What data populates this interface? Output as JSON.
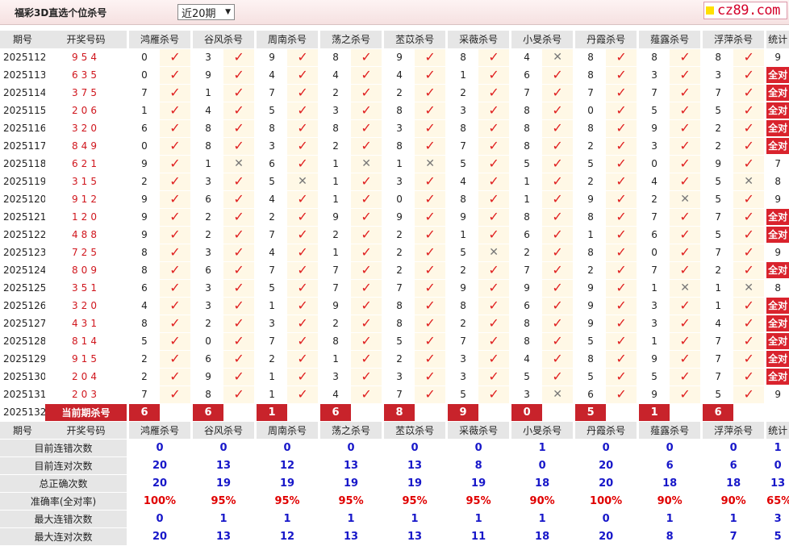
{
  "header": {
    "title": "福彩3D直选个位杀号",
    "period_select": "近20期",
    "logo_text": "cz89.com"
  },
  "columns": {
    "period": "期号",
    "draw": "开奖号码",
    "stat": "统计",
    "experts": [
      "鸿雁杀号",
      "谷风杀号",
      "周南杀号",
      "荡之杀号",
      "苤苡杀号",
      "采薇杀号",
      "小旻杀号",
      "丹霞杀号",
      "薤露杀号",
      "浮萍杀号"
    ]
  },
  "rows": [
    {
      "period": "2025112",
      "draw": "954",
      "preds": [
        [
          0,
          1
        ],
        [
          3,
          1
        ],
        [
          9,
          1
        ],
        [
          8,
          1
        ],
        [
          9,
          1
        ],
        [
          8,
          1
        ],
        [
          4,
          0
        ],
        [
          8,
          1
        ],
        [
          8,
          1
        ],
        [
          8,
          1
        ]
      ],
      "stat": "9"
    },
    {
      "period": "2025113",
      "draw": "635",
      "preds": [
        [
          0,
          1
        ],
        [
          9,
          1
        ],
        [
          4,
          1
        ],
        [
          4,
          1
        ],
        [
          4,
          1
        ],
        [
          1,
          1
        ],
        [
          6,
          1
        ],
        [
          8,
          1
        ],
        [
          3,
          1
        ],
        [
          3,
          1
        ]
      ],
      "stat": "全对"
    },
    {
      "period": "2025114",
      "draw": "375",
      "preds": [
        [
          7,
          1
        ],
        [
          1,
          1
        ],
        [
          7,
          1
        ],
        [
          2,
          1
        ],
        [
          2,
          1
        ],
        [
          2,
          1
        ],
        [
          7,
          1
        ],
        [
          7,
          1
        ],
        [
          7,
          1
        ],
        [
          7,
          1
        ]
      ],
      "stat": "全对"
    },
    {
      "period": "2025115",
      "draw": "206",
      "preds": [
        [
          1,
          1
        ],
        [
          4,
          1
        ],
        [
          5,
          1
        ],
        [
          3,
          1
        ],
        [
          8,
          1
        ],
        [
          3,
          1
        ],
        [
          8,
          1
        ],
        [
          0,
          1
        ],
        [
          5,
          1
        ],
        [
          5,
          1
        ]
      ],
      "stat": "全对"
    },
    {
      "period": "2025116",
      "draw": "320",
      "preds": [
        [
          6,
          1
        ],
        [
          8,
          1
        ],
        [
          8,
          1
        ],
        [
          8,
          1
        ],
        [
          3,
          1
        ],
        [
          8,
          1
        ],
        [
          8,
          1
        ],
        [
          8,
          1
        ],
        [
          9,
          1
        ],
        [
          2,
          1
        ]
      ],
      "stat": "全对"
    },
    {
      "period": "2025117",
      "draw": "849",
      "preds": [
        [
          0,
          1
        ],
        [
          8,
          1
        ],
        [
          3,
          1
        ],
        [
          2,
          1
        ],
        [
          8,
          1
        ],
        [
          7,
          1
        ],
        [
          8,
          1
        ],
        [
          2,
          1
        ],
        [
          3,
          1
        ],
        [
          2,
          1
        ]
      ],
      "stat": "全对"
    },
    {
      "period": "2025118",
      "draw": "621",
      "preds": [
        [
          9,
          1
        ],
        [
          1,
          0
        ],
        [
          6,
          1
        ],
        [
          1,
          0
        ],
        [
          1,
          0
        ],
        [
          5,
          1
        ],
        [
          5,
          1
        ],
        [
          5,
          1
        ],
        [
          0,
          1
        ],
        [
          9,
          1
        ]
      ],
      "stat": "7"
    },
    {
      "period": "2025119",
      "draw": "315",
      "preds": [
        [
          2,
          1
        ],
        [
          3,
          1
        ],
        [
          5,
          0
        ],
        [
          1,
          1
        ],
        [
          3,
          1
        ],
        [
          4,
          1
        ],
        [
          1,
          1
        ],
        [
          2,
          1
        ],
        [
          4,
          1
        ],
        [
          5,
          0
        ]
      ],
      "stat": "8"
    },
    {
      "period": "2025120",
      "draw": "912",
      "preds": [
        [
          9,
          1
        ],
        [
          6,
          1
        ],
        [
          4,
          1
        ],
        [
          1,
          1
        ],
        [
          0,
          1
        ],
        [
          8,
          1
        ],
        [
          1,
          1
        ],
        [
          9,
          1
        ],
        [
          2,
          0
        ],
        [
          5,
          1
        ]
      ],
      "stat": "9"
    },
    {
      "period": "2025121",
      "draw": "120",
      "preds": [
        [
          9,
          1
        ],
        [
          2,
          1
        ],
        [
          2,
          1
        ],
        [
          9,
          1
        ],
        [
          9,
          1
        ],
        [
          9,
          1
        ],
        [
          8,
          1
        ],
        [
          8,
          1
        ],
        [
          7,
          1
        ],
        [
          7,
          1
        ]
      ],
      "stat": "全对"
    },
    {
      "period": "2025122",
      "draw": "488",
      "preds": [
        [
          9,
          1
        ],
        [
          2,
          1
        ],
        [
          7,
          1
        ],
        [
          2,
          1
        ],
        [
          2,
          1
        ],
        [
          1,
          1
        ],
        [
          6,
          1
        ],
        [
          1,
          1
        ],
        [
          6,
          1
        ],
        [
          5,
          1
        ]
      ],
      "stat": "全对"
    },
    {
      "period": "2025123",
      "draw": "725",
      "preds": [
        [
          8,
          1
        ],
        [
          3,
          1
        ],
        [
          4,
          1
        ],
        [
          1,
          1
        ],
        [
          2,
          1
        ],
        [
          5,
          0
        ],
        [
          2,
          1
        ],
        [
          8,
          1
        ],
        [
          0,
          1
        ],
        [
          7,
          1
        ]
      ],
      "stat": "9"
    },
    {
      "period": "2025124",
      "draw": "809",
      "preds": [
        [
          8,
          1
        ],
        [
          6,
          1
        ],
        [
          7,
          1
        ],
        [
          7,
          1
        ],
        [
          2,
          1
        ],
        [
          2,
          1
        ],
        [
          7,
          1
        ],
        [
          2,
          1
        ],
        [
          7,
          1
        ],
        [
          2,
          1
        ]
      ],
      "stat": "全对"
    },
    {
      "period": "2025125",
      "draw": "351",
      "preds": [
        [
          6,
          1
        ],
        [
          3,
          1
        ],
        [
          5,
          1
        ],
        [
          7,
          1
        ],
        [
          7,
          1
        ],
        [
          9,
          1
        ],
        [
          9,
          1
        ],
        [
          9,
          1
        ],
        [
          1,
          0
        ],
        [
          1,
          0
        ]
      ],
      "stat": "8"
    },
    {
      "period": "2025126",
      "draw": "320",
      "preds": [
        [
          4,
          1
        ],
        [
          3,
          1
        ],
        [
          1,
          1
        ],
        [
          9,
          1
        ],
        [
          8,
          1
        ],
        [
          8,
          1
        ],
        [
          6,
          1
        ],
        [
          9,
          1
        ],
        [
          3,
          1
        ],
        [
          1,
          1
        ]
      ],
      "stat": "全对"
    },
    {
      "period": "2025127",
      "draw": "431",
      "preds": [
        [
          8,
          1
        ],
        [
          2,
          1
        ],
        [
          3,
          1
        ],
        [
          2,
          1
        ],
        [
          8,
          1
        ],
        [
          2,
          1
        ],
        [
          8,
          1
        ],
        [
          9,
          1
        ],
        [
          3,
          1
        ],
        [
          4,
          1
        ]
      ],
      "stat": "全对"
    },
    {
      "period": "2025128",
      "draw": "814",
      "preds": [
        [
          5,
          1
        ],
        [
          0,
          1
        ],
        [
          7,
          1
        ],
        [
          8,
          1
        ],
        [
          5,
          1
        ],
        [
          7,
          1
        ],
        [
          8,
          1
        ],
        [
          5,
          1
        ],
        [
          1,
          1
        ],
        [
          7,
          1
        ]
      ],
      "stat": "全对"
    },
    {
      "period": "2025129",
      "draw": "915",
      "preds": [
        [
          2,
          1
        ],
        [
          6,
          1
        ],
        [
          2,
          1
        ],
        [
          1,
          1
        ],
        [
          2,
          1
        ],
        [
          3,
          1
        ],
        [
          4,
          1
        ],
        [
          8,
          1
        ],
        [
          9,
          1
        ],
        [
          7,
          1
        ]
      ],
      "stat": "全对"
    },
    {
      "period": "2025130",
      "draw": "204",
      "preds": [
        [
          2,
          1
        ],
        [
          9,
          1
        ],
        [
          1,
          1
        ],
        [
          3,
          1
        ],
        [
          3,
          1
        ],
        [
          3,
          1
        ],
        [
          5,
          1
        ],
        [
          5,
          1
        ],
        [
          5,
          1
        ],
        [
          7,
          1
        ]
      ],
      "stat": "全对"
    },
    {
      "period": "2025131",
      "draw": "203",
      "preds": [
        [
          7,
          1
        ],
        [
          8,
          1
        ],
        [
          1,
          1
        ],
        [
          4,
          1
        ],
        [
          7,
          1
        ],
        [
          5,
          1
        ],
        [
          3,
          0
        ],
        [
          6,
          1
        ],
        [
          9,
          1
        ],
        [
          5,
          1
        ]
      ],
      "stat": "9"
    }
  ],
  "current": {
    "period": "2025132",
    "label": "当前期杀号",
    "kills": [
      "6",
      "6",
      "1",
      "6",
      "8",
      "9",
      "0",
      "5",
      "1",
      "6"
    ]
  },
  "stats": [
    {
      "label": "目前连错次数",
      "values": [
        "0",
        "0",
        "0",
        "0",
        "0",
        "0",
        "1",
        "0",
        "0",
        "0"
      ],
      "stat": "1",
      "cls": "sv"
    },
    {
      "label": "目前连对次数",
      "values": [
        "20",
        "13",
        "12",
        "13",
        "13",
        "8",
        "0",
        "20",
        "6",
        "6"
      ],
      "stat": "0",
      "cls": "sv"
    },
    {
      "label": "总正确次数",
      "values": [
        "20",
        "19",
        "19",
        "19",
        "19",
        "19",
        "18",
        "20",
        "18",
        "18"
      ],
      "stat": "13",
      "cls": "sv"
    },
    {
      "label": "准确率(全对率)",
      "values": [
        "100%",
        "95%",
        "95%",
        "95%",
        "95%",
        "95%",
        "90%",
        "100%",
        "90%",
        "90%"
      ],
      "stat": "65%",
      "cls": "rate"
    },
    {
      "label": "最大连错次数",
      "values": [
        "0",
        "1",
        "1",
        "1",
        "1",
        "1",
        "1",
        "0",
        "1",
        "1"
      ],
      "stat": "3",
      "cls": "sv"
    },
    {
      "label": "最大连对次数",
      "values": [
        "20",
        "13",
        "12",
        "13",
        "13",
        "11",
        "18",
        "20",
        "8",
        "7"
      ],
      "stat": "5",
      "cls": "sv"
    }
  ],
  "colors": {
    "accent_red": "#d9232d",
    "stat_blue": "#1717c9",
    "header_gray": "#e6e6e6",
    "mark_cell": "#fff8e6"
  }
}
